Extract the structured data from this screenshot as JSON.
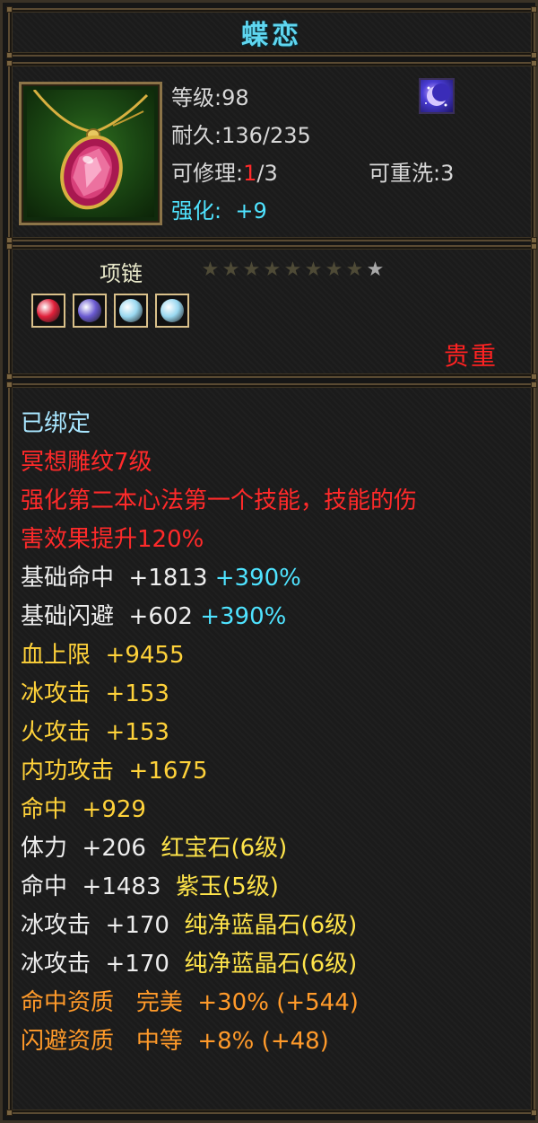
{
  "item": {
    "name": "蝶恋",
    "level_label": "等级",
    "level": "98",
    "durability_label": "耐久",
    "durability": "136/235",
    "repair_label": "可修理",
    "repair_current": "1",
    "repair_max": "/3",
    "rewash_label": "可重洗",
    "rewash_value": "3",
    "enhance_label": "强化:",
    "enhance_value": "+9",
    "icon": "pendant-necklace-icon",
    "skill_icon": "moon-skill-icon"
  },
  "type_info": {
    "item_type": "项链",
    "stars_total": 9,
    "stars_lit": 1,
    "gems": [
      {
        "icon": "ruby-gem-icon",
        "color": "#e0203a"
      },
      {
        "icon": "amethyst-gem-icon",
        "color": "#6a5ad0"
      },
      {
        "icon": "blue-crystal-gem-icon",
        "color": "#9ad8f0"
      },
      {
        "icon": "blue-crystal-gem-icon",
        "color": "#9ad8f0"
      }
    ],
    "rarity": "贵重"
  },
  "attributes": {
    "bound": "已绑定",
    "engraving": "冥想雕纹7级",
    "effect_line1": "强化第二本心法第一个技能，技能的伤",
    "effect_line2": "害效果提升120%",
    "stats": [
      {
        "label": "基础命中",
        "value": "+1813",
        "bonus": "+390%",
        "color": "white"
      },
      {
        "label": "基础闪避",
        "value": "+602",
        "bonus": "+390%",
        "color": "white"
      },
      {
        "label": "血上限",
        "value": "+9455",
        "bonus": "",
        "color": "yellow"
      },
      {
        "label": "冰攻击",
        "value": "+153",
        "bonus": "",
        "color": "yellow"
      },
      {
        "label": "火攻击",
        "value": "+153",
        "bonus": "",
        "color": "yellow"
      },
      {
        "label": "内功攻击",
        "value": "+1675",
        "bonus": "",
        "color": "yellow"
      },
      {
        "label": "命中",
        "value": "+929",
        "bonus": "",
        "color": "yellow"
      }
    ],
    "gem_stats": [
      {
        "label": "体力",
        "value": "+206",
        "gem": "红宝石(6级)"
      },
      {
        "label": "命中",
        "value": "+1483",
        "gem": "紫玉(5级)"
      },
      {
        "label": "冰攻击",
        "value": "+170",
        "gem": "纯净蓝晶石(6级)"
      },
      {
        "label": "冰攻击",
        "value": "+170",
        "gem": "纯净蓝晶石(6级)"
      }
    ],
    "aptitudes": [
      {
        "label": "命中资质",
        "grade": "完美",
        "pct": "+30%",
        "extra": "(+544)"
      },
      {
        "label": "闪避资质",
        "grade": "中等",
        "pct": "+8%",
        "extra": "(+48)"
      }
    ]
  },
  "colors": {
    "title": "#5fd6f0",
    "bound": "#a8e6ff",
    "red": "#ff2a2a",
    "cyan": "#4fe3ff",
    "yellow": "#ffd23a",
    "orange": "#ff9a2a"
  }
}
